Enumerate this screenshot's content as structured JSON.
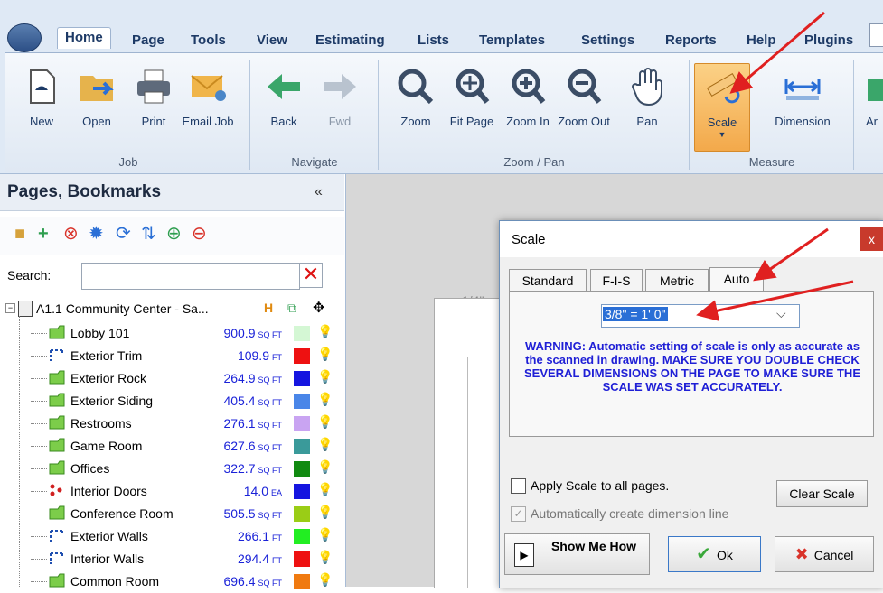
{
  "ribbon": {
    "tabs": [
      "Home",
      "Page",
      "Tools",
      "View",
      "Estimating",
      "Lists",
      "Templates",
      "Settings",
      "Reports",
      "Help",
      "Plugins"
    ],
    "buttons": {
      "new": "New",
      "open": "Open",
      "print": "Print",
      "email": "Email Job",
      "back": "Back",
      "fwd": "Fwd",
      "zoom": "Zoom",
      "fit_page": "Fit Page",
      "zoom_in": "Zoom In",
      "zoom_out": "Zoom Out",
      "pan": "Pan",
      "scale": "Scale",
      "dimension": "Dimension",
      "more": "Ar"
    },
    "groups": {
      "job": "Job",
      "navigate": "Navigate",
      "zoompan": "Zoom / Pan",
      "measure": "Measure"
    }
  },
  "left_panel": {
    "title": "Pages, Bookmarks",
    "collapse": "«",
    "search_label": "Search:",
    "search_value": "",
    "root": "A1.1 Community Center - Sa...",
    "rows": [
      {
        "name": "Lobby 101",
        "value": "900.9",
        "unit": "SQ FT",
        "color": "#d4f7d4",
        "kind": "area"
      },
      {
        "name": "Exterior Trim",
        "value": "109.9",
        "unit": "FT",
        "color": "#ee1111",
        "kind": "linear"
      },
      {
        "name": "Exterior Rock",
        "value": "264.9",
        "unit": "SQ FT",
        "color": "#1515e0",
        "kind": "area"
      },
      {
        "name": "Exterior Siding",
        "value": "405.4",
        "unit": "SQ FT",
        "color": "#4a86e8",
        "kind": "area"
      },
      {
        "name": "Restrooms",
        "value": "276.1",
        "unit": "SQ FT",
        "color": "#c9a4f2",
        "kind": "area"
      },
      {
        "name": "Game Room",
        "value": "627.6",
        "unit": "SQ FT",
        "color": "#3a9a9a",
        "kind": "area"
      },
      {
        "name": "Offices",
        "value": "322.7",
        "unit": "SQ FT",
        "color": "#118a11",
        "kind": "area"
      },
      {
        "name": "Interior Doors",
        "value": "14.0",
        "unit": "EA",
        "color": "#1515e0",
        "kind": "count"
      },
      {
        "name": "Conference Room",
        "value": "505.5",
        "unit": "SQ FT",
        "color": "#9acd16",
        "kind": "area"
      },
      {
        "name": "Exterior Walls",
        "value": "266.1",
        "unit": "FT",
        "color": "#22ee22",
        "kind": "linear"
      },
      {
        "name": "Interior Walls",
        "value": "294.4",
        "unit": "FT",
        "color": "#ee1111",
        "kind": "linear"
      },
      {
        "name": "Common Room",
        "value": "696.4",
        "unit": "SQ FT",
        "color": "#f07a10",
        "kind": "area"
      }
    ]
  },
  "canvas": {
    "scale_fragment": "1/4\""
  },
  "dialog": {
    "title": "Scale",
    "close": "x",
    "tabs": [
      "Standard",
      "F-I-S",
      "Metric",
      "Auto"
    ],
    "active_tab": "Auto",
    "scale_value": "3/8\" = 1' 0\"",
    "warning": "WARNING: Automatic setting of scale is only as accurate as the scanned in drawing. MAKE SURE YOU DOUBLE CHECK SEVERAL DIMENSIONS ON THE PAGE TO MAKE SURE THE SCALE WAS SET ACCURATELY.",
    "apply_all": "Apply Scale to all pages.",
    "auto_dimension": "Automatically create dimension line",
    "clear_scale": "Clear Scale",
    "show_me": "Show Me How",
    "ok": "Ok",
    "cancel": "Cancel"
  }
}
